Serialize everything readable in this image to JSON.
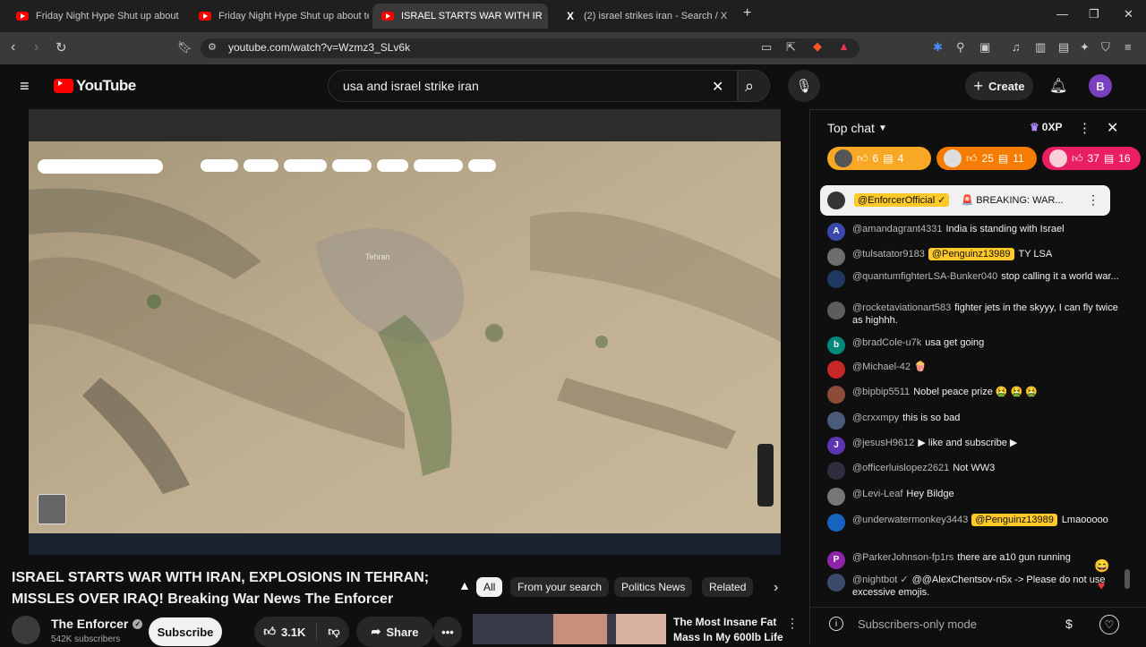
{
  "browser": {
    "tabs": [
      {
        "title": "Friday Night Hype Shut up about",
        "icon": "youtube-favicon"
      },
      {
        "title": "Friday Night Hype Shut up about te",
        "icon": "youtube-favicon"
      },
      {
        "title": "ISRAEL STARTS WAR WITH IR",
        "icon": "youtube-favicon",
        "active": true
      },
      {
        "title": "(2) israel strikes iran - Search / X",
        "icon": "x-favicon"
      }
    ],
    "url": "youtube.com/watch?v=Wzmz3_SLv6k"
  },
  "youtube": {
    "logo_text": "YouTube",
    "search_value": "usa and israel strike iran",
    "create_label": "Create",
    "avatar_letter": "B"
  },
  "video": {
    "title": "ISRAEL STARTS WAR WITH IRAN, EXPLOSIONS IN TEHRAN; MISSLES OVER IRAQ! Breaking War News The Enforcer",
    "map_label": "Tehran",
    "channel": "The Enforcer",
    "subscribers": "542K subscribers",
    "subscribe_label": "Subscribe",
    "likes": "3.1K",
    "share_label": "Share"
  },
  "chips": [
    "All",
    "From your search",
    "Politics News",
    "Related"
  ],
  "recommended": {
    "title_line1": "The Most Insane Fat",
    "title_line2": "Mass In My 600lb Life"
  },
  "chat": {
    "header": "Top chat",
    "xp": "0XP",
    "gift_chips": [
      {
        "a": "6",
        "b": "4",
        "color": "#f9a825"
      },
      {
        "a": "25",
        "b": "11",
        "color": "#f57c00"
      },
      {
        "a": "37",
        "b": "16",
        "color": "#e91e63"
      }
    ],
    "pinned": {
      "author": "@EnforcerOfficial ✓",
      "text": "🚨 BREAKING: WAR..."
    },
    "messages": [
      {
        "author": "@amandagrant4331",
        "text": "India is standing with Israel",
        "av": "A",
        "avc": "#3949ab"
      },
      {
        "author": "@tulsatator9183",
        "tag": "@Penguinz13989",
        "text": "TY LSA",
        "av": "",
        "avc": "#6d6d6d"
      },
      {
        "author": "@quantumfighterLSA-Bunker040",
        "text": "stop calling it a world war...",
        "av": "",
        "avc": "#1e3a5f"
      },
      {
        "author": "@rocketaviationart583",
        "text": "fighter jets in the skyyy, I can fly twice as highhh.",
        "av": "",
        "avc": "#5d5d5d"
      },
      {
        "author": "@bradCole-u7k",
        "text": "usa get going",
        "av": "b",
        "avc": "#00897b"
      },
      {
        "author": "@Michael-42",
        "text": "🍿",
        "av": "",
        "avc": "#c62828"
      },
      {
        "author": "@bipbip5511",
        "text": "Nobel peace prize 🤮 🤮 🤮",
        "av": "",
        "avc": "#8d4b3a"
      },
      {
        "author": "@crxxmpy",
        "text": "this is so bad",
        "av": "",
        "avc": "#4a5b7a"
      },
      {
        "author": "@jesusH9612",
        "text": "▶ like and subscribe ▶",
        "av": "J",
        "avc": "#5e35b1"
      },
      {
        "author": "@officerluislopez2621",
        "text": "Not WW3",
        "av": "",
        "avc": "#2e2e3e"
      },
      {
        "author": "@Levi-Leaf",
        "text": "Hey Bildge",
        "av": "",
        "avc": "#777"
      },
      {
        "author": "@underwatermonkey3443",
        "tag": "@Penguinz13989",
        "text": "Lmaooooo",
        "av": "",
        "avc": "#1565c0"
      },
      {
        "author": "@ParkerJohnson-fp1rs",
        "text": "there are a10 gun running",
        "av": "P",
        "avc": "#8e24aa"
      },
      {
        "author": "@nightbot ✓",
        "text": "@@AlexChentsov-n5x -> Please do not use excessive emojis.",
        "av": "",
        "avc": "#3c4a6b"
      }
    ],
    "footer_mode": "Subscribers-only mode"
  }
}
